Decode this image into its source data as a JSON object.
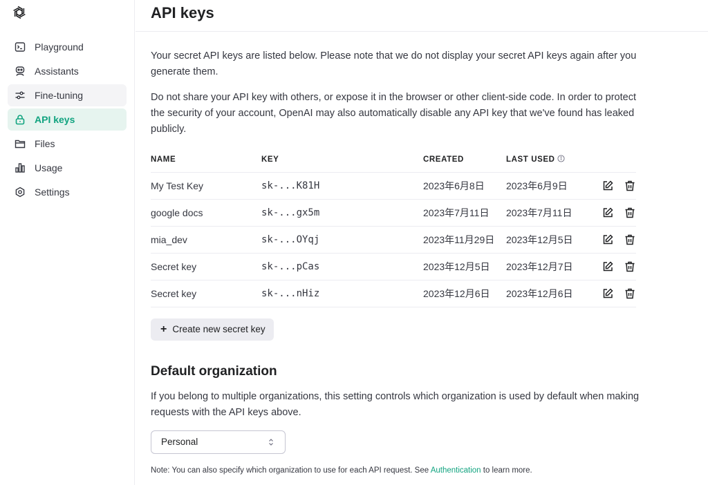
{
  "sidebar": {
    "items": [
      {
        "label": "Playground",
        "icon": "terminal-icon"
      },
      {
        "label": "Assistants",
        "icon": "robot-icon"
      },
      {
        "label": "Fine-tuning",
        "icon": "sliders-icon"
      },
      {
        "label": "API keys",
        "icon": "lock-icon"
      },
      {
        "label": "Files",
        "icon": "folder-icon"
      },
      {
        "label": "Usage",
        "icon": "bar-chart-icon"
      },
      {
        "label": "Settings",
        "icon": "gear-icon"
      }
    ],
    "active_index": 3
  },
  "page": {
    "title": "API keys",
    "intro1": "Your secret API keys are listed below. Please note that we do not display your secret API keys again after you generate them.",
    "intro2": "Do not share your API key with others, or expose it in the browser or other client-side code. In order to protect the security of your account, OpenAI may also automatically disable any API key that we've found has leaked publicly."
  },
  "table": {
    "headers": {
      "name": "NAME",
      "key": "KEY",
      "created": "CREATED",
      "last_used": "LAST USED"
    },
    "rows": [
      {
        "name": "My Test Key",
        "key": "sk-...K81H",
        "created": "2023年6月8日",
        "last_used": "2023年6月9日"
      },
      {
        "name": "google docs",
        "key": "sk-...gx5m",
        "created": "2023年7月11日",
        "last_used": "2023年7月11日"
      },
      {
        "name": "mia_dev",
        "key": "sk-...OYqj",
        "created": "2023年11月29日",
        "last_used": "2023年12月5日"
      },
      {
        "name": "Secret key",
        "key": "sk-...pCas",
        "created": "2023年12月5日",
        "last_used": "2023年12月7日"
      },
      {
        "name": "Secret key",
        "key": "sk-...nHiz",
        "created": "2023年12月6日",
        "last_used": "2023年12月6日"
      }
    ]
  },
  "create_button": {
    "plus": "+",
    "label": "Create new secret key"
  },
  "org": {
    "title": "Default organization",
    "description": "If you belong to multiple organizations, this setting controls which organization is used by default when making requests with the API keys above.",
    "selected": "Personal",
    "note_before": "Note: You can also specify which organization to use for each API request. See ",
    "note_link": "Authentication",
    "note_after": " to learn more."
  },
  "colors": {
    "accent": "#10a37f",
    "active_bg": "#e6f4ef",
    "border": "#ececf1"
  }
}
